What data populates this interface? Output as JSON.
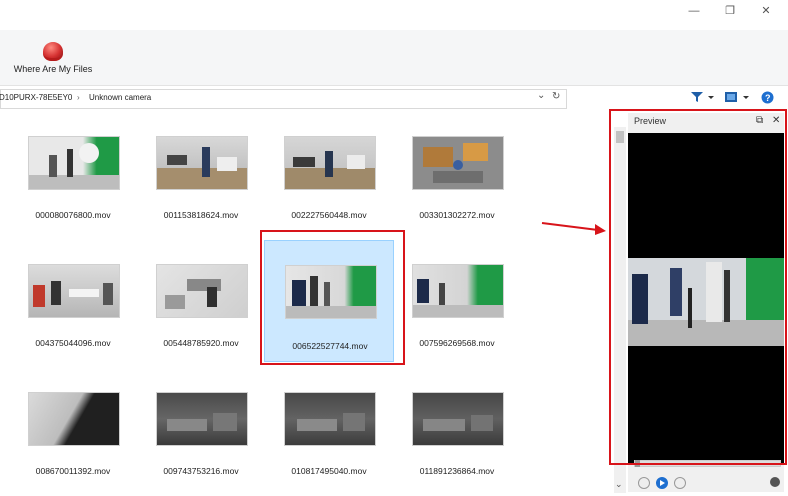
{
  "window": {
    "minimize_icon": "—",
    "restore_icon": "❐",
    "close_icon": "✕"
  },
  "ribbon": {
    "tool_label": "Where Are My Files"
  },
  "address": {
    "device": "D10PURX-78E5EY0",
    "separator": "›",
    "folder": "Unknown camera",
    "dropdown": "⌄",
    "refresh": "↻"
  },
  "files": [
    {
      "name": "000080076800.mov",
      "selected": false
    },
    {
      "name": "001153818624.mov",
      "selected": false
    },
    {
      "name": "002227560448.mov",
      "selected": false
    },
    {
      "name": "003301302272.mov",
      "selected": false
    },
    {
      "name": "004375044096.mov",
      "selected": false
    },
    {
      "name": "005448785920.mov",
      "selected": false
    },
    {
      "name": "006522527744.mov",
      "selected": true
    },
    {
      "name": "007596269568.mov",
      "selected": false
    },
    {
      "name": "008670011392.mov",
      "selected": false
    },
    {
      "name": "009743753216.mov",
      "selected": false
    },
    {
      "name": "010817495040.mov",
      "selected": false
    },
    {
      "name": "011891236864.mov",
      "selected": false
    }
  ],
  "preview": {
    "title": "Preview",
    "undock_icon": "⧉",
    "close_icon": "✕"
  },
  "colors": {
    "highlight": "#d8141a",
    "selection": "#cce8ff",
    "accent_blue": "#1e6fd0"
  }
}
